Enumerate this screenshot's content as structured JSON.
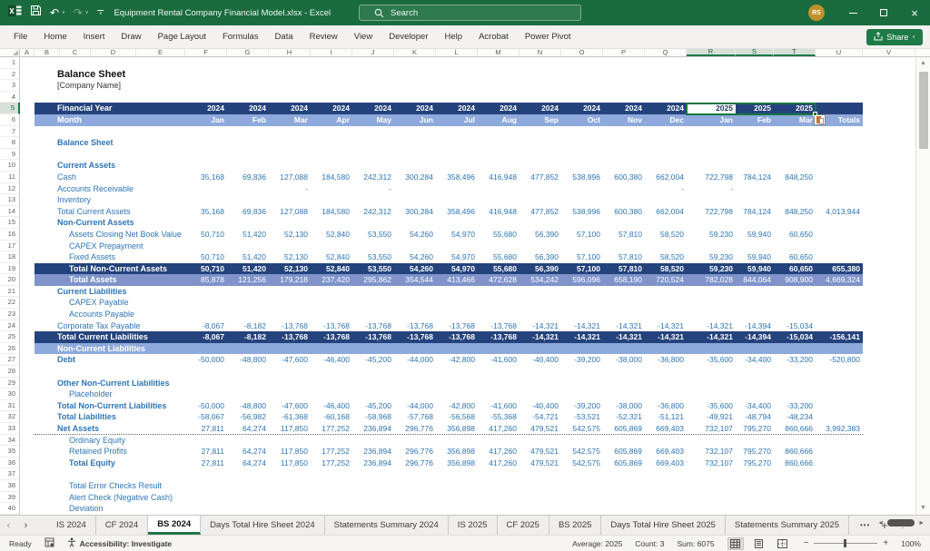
{
  "titlebar": {
    "title": "Equipment Rental Company Financial Model.xlsx  -  Excel",
    "search_placeholder": "Search",
    "avatar_initials": "RS"
  },
  "icons": {
    "undo": "↶",
    "redo": "↷",
    "chevron": "∨",
    "close": "×",
    "tab_prev": "‹",
    "tab_next": "›",
    "more_tabs": "•••",
    "add_sheet": "+",
    "splitter": "⋮",
    "scroll_up": "▲",
    "scroll_down": "▼",
    "scroll_left": "◄",
    "scroll_right": "►",
    "zoom_out": "−",
    "zoom_in": "+"
  },
  "ribbon": {
    "tabs": [
      "File",
      "Home",
      "Insert",
      "Draw",
      "Page Layout",
      "Formulas",
      "Data",
      "Review",
      "View",
      "Developer",
      "Help",
      "Acrobat",
      "Power Pivot"
    ],
    "share_label": "Share"
  },
  "sheet": {
    "columns": [
      "A",
      "B",
      "C",
      "D",
      "E",
      "F",
      "G",
      "H",
      "I",
      "J",
      "K",
      "L",
      "M",
      "N",
      "O",
      "P",
      "Q",
      "R",
      "S",
      "T",
      "U",
      "V"
    ],
    "selected_columns": [
      "R",
      "S",
      "T"
    ],
    "selection": {
      "row": 5,
      "active_index": 12
    },
    "rows": [
      {
        "n": 1
      },
      {
        "n": 2,
        "label": "Balance Sheet",
        "style": "h1"
      },
      {
        "n": 3,
        "label": "[Company Name]",
        "style": "sub"
      },
      {
        "n": 4
      },
      {
        "n": 5,
        "label": "Financial Year",
        "style": "bandDark",
        "vals": [
          "2024",
          "2024",
          "2024",
          "2024",
          "2024",
          "2024",
          "2024",
          "2024",
          "2024",
          "2024",
          "2024",
          "2024",
          "2025",
          "2025",
          "2025",
          ""
        ]
      },
      {
        "n": 6,
        "label": "Month",
        "style": "bandLight",
        "paste_icon": true,
        "vals": [
          "Jan",
          "Feb",
          "Mar",
          "Apr",
          "May",
          "Jun",
          "Jul",
          "Aug",
          "Sep",
          "Oct",
          "Nov",
          "Dec",
          "Jan",
          "Feb",
          "Mar",
          "Totals"
        ]
      },
      {
        "n": 7
      },
      {
        "n": 8,
        "label": "Balance Sheet",
        "style": "bold"
      },
      {
        "n": 9
      },
      {
        "n": 10,
        "label": "Current Assets",
        "style": "bold"
      },
      {
        "n": 11,
        "label": "Cash",
        "style": "plain",
        "vals": [
          "35,168",
          "69,836",
          "127,088",
          "184,580",
          "242,312",
          "300,284",
          "358,496",
          "416,948",
          "477,852",
          "538,996",
          "600,380",
          "662,004",
          "722,798",
          "784,124",
          "848,250",
          ""
        ]
      },
      {
        "n": 12,
        "label": "Accounts Receivable",
        "style": "plain",
        "vals": [
          "",
          "",
          "-",
          "",
          "-",
          "",
          "",
          "",
          "",
          "",
          "",
          "-",
          "-",
          "",
          "",
          ""
        ]
      },
      {
        "n": 13,
        "label": "Inventory",
        "style": "plain"
      },
      {
        "n": 14,
        "label": "Total Current Assets",
        "style": "plain",
        "vals": [
          "35,168",
          "69,836",
          "127,088",
          "184,580",
          "242,312",
          "300,284",
          "358,496",
          "416,948",
          "477,852",
          "538,996",
          "600,380",
          "662,004",
          "722,798",
          "784,124",
          "848,250",
          "4,013,944"
        ]
      },
      {
        "n": 15,
        "label": "Non-Current Assets",
        "style": "bold"
      },
      {
        "n": 16,
        "label": "Assets Closing Net Book Value",
        "style": "plain",
        "indent": 1,
        "vals": [
          "50,710",
          "51,420",
          "52,130",
          "52,840",
          "53,550",
          "54,260",
          "54,970",
          "55,680",
          "56,390",
          "57,100",
          "57,810",
          "58,520",
          "59,230",
          "59,940",
          "60,650",
          ""
        ]
      },
      {
        "n": 17,
        "label": "CAPEX Prepayment",
        "style": "plain",
        "indent": 1
      },
      {
        "n": 18,
        "label": "Fixed Assets",
        "style": "plain",
        "indent": 1,
        "vals": [
          "50,710",
          "51,420",
          "52,130",
          "52,840",
          "53,550",
          "54,260",
          "54,970",
          "55,680",
          "56,390",
          "57,100",
          "57,810",
          "58,520",
          "59,230",
          "59,940",
          "60,650",
          ""
        ]
      },
      {
        "n": 19,
        "label": "Total Non-Current Assets",
        "style": "bandDark",
        "indent": 1,
        "vals": [
          "50,710",
          "51,420",
          "52,130",
          "52,840",
          "53,550",
          "54,260",
          "54,970",
          "55,680",
          "56,390",
          "57,100",
          "57,810",
          "58,520",
          "59,230",
          "59,940",
          "60,650",
          "655,380"
        ]
      },
      {
        "n": 20,
        "label": "Total Assets",
        "style": "bandMid",
        "indent": 1,
        "vals": [
          "85,878",
          "121,256",
          "179,218",
          "237,420",
          "295,862",
          "354,544",
          "413,466",
          "472,628",
          "534,242",
          "596,096",
          "658,190",
          "720,524",
          "782,028",
          "844,064",
          "908,900",
          "4,669,324"
        ]
      },
      {
        "n": 21,
        "label": "Current Liabilities",
        "style": "bold"
      },
      {
        "n": 22,
        "label": "CAPEX Payable",
        "style": "plain",
        "indent": 1
      },
      {
        "n": 23,
        "label": "Accounts Payable",
        "style": "plain",
        "indent": 1
      },
      {
        "n": 24,
        "label": "Corporate Tax Payable",
        "style": "plain",
        "vals": [
          "-8,067",
          "-8,182",
          "-13,768",
          "-13,768",
          "-13,768",
          "-13,768",
          "-13,768",
          "-13,768",
          "-14,321",
          "-14,321",
          "-14,321",
          "-14,321",
          "-14,321",
          "-14,394",
          "-15,034",
          ""
        ]
      },
      {
        "n": 25,
        "label": "Total Current Liabilities",
        "style": "bandDark",
        "vals": [
          "-8,067",
          "-8,182",
          "-13,768",
          "-13,768",
          "-13,768",
          "-13,768",
          "-13,768",
          "-13,768",
          "-14,321",
          "-14,321",
          "-14,321",
          "-14,321",
          "-14,321",
          "-14,394",
          "-15,034",
          "-156,141"
        ]
      },
      {
        "n": 26,
        "label": "Non-Current Liabilities",
        "style": "bandLight"
      },
      {
        "n": 27,
        "label": "Debt",
        "style": "bold",
        "vals": [
          "-50,000",
          "-48,800",
          "-47,600",
          "-46,400",
          "-45,200",
          "-44,000",
          "-42,800",
          "-41,600",
          "-40,400",
          "-39,200",
          "-38,000",
          "-36,800",
          "-35,600",
          "-34,400",
          "-33,200",
          "-520,800"
        ]
      },
      {
        "n": 28
      },
      {
        "n": 29,
        "label": "Other Non-Current Liabilities",
        "style": "bold"
      },
      {
        "n": 30,
        "label": "Placeholder",
        "style": "plain",
        "indent": 1
      },
      {
        "n": 31,
        "label": "Total Non-Current Liabilities",
        "style": "bold",
        "vals": [
          "-50,000",
          "-48,800",
          "-47,600",
          "-46,400",
          "-45,200",
          "-44,000",
          "-42,800",
          "-41,600",
          "-40,400",
          "-39,200",
          "-38,000",
          "-36,800",
          "-35,600",
          "-34,400",
          "-33,200",
          ""
        ]
      },
      {
        "n": 32,
        "label": "Total Liabilities",
        "style": "bold",
        "vals": [
          "-58,067",
          "-56,982",
          "-61,368",
          "-60,168",
          "-58,968",
          "-57,768",
          "-56,568",
          "-55,368",
          "-54,721",
          "-53,521",
          "-52,321",
          "-51,121",
          "-49,921",
          "-48,794",
          "-48,234",
          ""
        ]
      },
      {
        "n": 33,
        "label": "Net Assets",
        "style": "bold",
        "dotted": true,
        "vals": [
          "27,811",
          "64,274",
          "117,850",
          "177,252",
          "236,894",
          "296,776",
          "356,898",
          "417,260",
          "479,521",
          "542,575",
          "605,869",
          "669,403",
          "732,107",
          "795,270",
          "860,666",
          "3,992,383"
        ]
      },
      {
        "n": 34,
        "label": "Ordinary Equity",
        "style": "plain",
        "indent": 1
      },
      {
        "n": 35,
        "label": "Retained Profits",
        "style": "plain",
        "indent": 1,
        "vals": [
          "27,811",
          "64,274",
          "117,850",
          "177,252",
          "236,894",
          "296,776",
          "356,898",
          "417,260",
          "479,521",
          "542,575",
          "605,869",
          "669,403",
          "732,107",
          "795,270",
          "860,666",
          ""
        ]
      },
      {
        "n": 36,
        "label": "Total Equity",
        "style": "bold",
        "indent": 1,
        "vals": [
          "27,811",
          "64,274",
          "117,850",
          "177,252",
          "236,894",
          "296,776",
          "356,898",
          "417,260",
          "479,521",
          "542,575",
          "605,869",
          "669,403",
          "732,107",
          "795,270",
          "860,666",
          ""
        ]
      },
      {
        "n": 37
      },
      {
        "n": 38,
        "label": "Total Error Checks Result",
        "style": "plain",
        "indent": 1
      },
      {
        "n": 39,
        "label": "Alert Check (Negative Cash)",
        "style": "plain",
        "indent": 1
      },
      {
        "n": 40,
        "label": "Deviation",
        "style": "plain",
        "indent": 1
      }
    ]
  },
  "sheet_tabs": {
    "tabs": [
      "IS 2024",
      "CF 2024",
      "BS 2024",
      "Days Total Hire Sheet 2024",
      "Statements Summary 2024",
      "IS 2025",
      "CF 2025",
      "BS 2025",
      "Days Total Hire Sheet 2025",
      "Statements Summary 2025"
    ],
    "active": "BS 2024"
  },
  "statusbar": {
    "ready": "Ready",
    "accessibility": "Accessibility: Investigate",
    "average": "Average: 2025",
    "count": "Count: 3",
    "sum": "Sum: 6075",
    "zoom": "100%"
  }
}
